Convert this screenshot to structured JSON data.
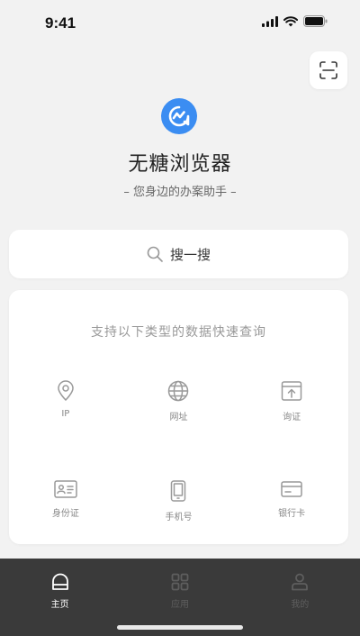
{
  "status": {
    "time": "9:41"
  },
  "app": {
    "title": "无糖浏览器",
    "subtitle": "– 您身边的办案助手 –",
    "brand_color": "#3b8df2"
  },
  "search": {
    "label": "搜一搜"
  },
  "query_card": {
    "heading": "支持以下类型的数据快速查询",
    "items": [
      {
        "label": "IP",
        "icon": "location-pin-icon"
      },
      {
        "label": "网址",
        "icon": "globe-icon"
      },
      {
        "label": "询证",
        "icon": "upload-box-icon"
      },
      {
        "label": "身份证",
        "icon": "id-card-icon"
      },
      {
        "label": "手机号",
        "icon": "phone-icon"
      },
      {
        "label": "银行卡",
        "icon": "bank-card-icon"
      }
    ]
  },
  "tabs": [
    {
      "label": "主页",
      "icon": "home-icon",
      "active": true
    },
    {
      "label": "应用",
      "icon": "apps-grid-icon",
      "active": false
    },
    {
      "label": "我的",
      "icon": "user-icon",
      "active": false
    }
  ]
}
